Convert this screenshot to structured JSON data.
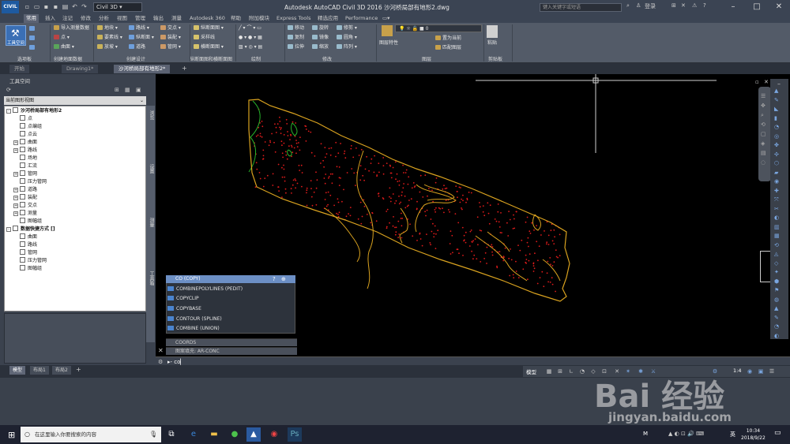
{
  "titlebar": {
    "app_button": "CIVIL",
    "workspace": "Civil 3D",
    "title": "Autodesk AutoCAD Civil 3D 2016    沙河桥局部有地形2.dwg",
    "search_placeholder": "键入关键字或短语",
    "login": "登录"
  },
  "ribbon_tabs": [
    "常用",
    "插入",
    "注记",
    "修改",
    "分析",
    "视图",
    "管理",
    "输出",
    "测量",
    "Autodesk 360",
    "帮助",
    "附加模块",
    "Express Tools",
    "精选应用",
    "Performance"
  ],
  "ribbon": {
    "big_button": "工具空间",
    "items": {
      "import_survey": "导入测量数据",
      "point": "点",
      "surface": "曲面",
      "parcel": "地块",
      "feature_line": "要素线",
      "grading": "放坡",
      "alignment": "路线",
      "profile": "纵断面",
      "corridor": "道路",
      "intersection": "交点",
      "assembly": "装配",
      "pipe_network": "管网",
      "profile_view": "纵断面图",
      "sample_line": "采样线",
      "section_view": "横断面图",
      "move": "移动",
      "rotate": "旋转",
      "trim": "修剪",
      "copy": "复制",
      "mirror": "镜像",
      "fillet": "圆角",
      "stretch": "拉伸",
      "scale": "缩放",
      "array": "阵列",
      "layer_properties": "图层特性",
      "layer_match": "置为当前",
      "layer_match2": "匹配图层",
      "paste": "粘贴",
      "layer_value": "0"
    },
    "panels": [
      "选项板",
      "创建地面数据",
      "创建设计",
      "纵断面图和横断面图",
      "绘制",
      "修改",
      "图层",
      "剪贴板"
    ]
  },
  "doc_tabs": [
    "开始",
    "Drawing1*",
    "沙河桥局部有地形2*"
  ],
  "toolspace": {
    "title": "工具空间",
    "view": "当前图形视图",
    "tree": [
      {
        "label": "沙河桥局部有地形2",
        "level": 0,
        "pm": "-"
      },
      {
        "label": "点",
        "level": 1,
        "pm": ""
      },
      {
        "label": "点编组",
        "level": 1,
        "pm": ""
      },
      {
        "label": "点云",
        "level": 1,
        "pm": ""
      },
      {
        "label": "曲面",
        "level": 1,
        "pm": "+"
      },
      {
        "label": "路线",
        "level": 1,
        "pm": "+"
      },
      {
        "label": "场地",
        "level": 1,
        "pm": ""
      },
      {
        "label": "汇流",
        "level": 1,
        "pm": ""
      },
      {
        "label": "管网",
        "level": 1,
        "pm": "+"
      },
      {
        "label": "压力管网",
        "level": 1,
        "pm": ""
      },
      {
        "label": "道路",
        "level": 1,
        "pm": "+"
      },
      {
        "label": "装配",
        "level": 1,
        "pm": "+"
      },
      {
        "label": "交点",
        "level": 1,
        "pm": "+"
      },
      {
        "label": "测量",
        "level": 1,
        "pm": "+"
      },
      {
        "label": "图幅组",
        "level": 1,
        "pm": ""
      },
      {
        "label": "数据快捷方式 []",
        "level": 0,
        "pm": "-"
      },
      {
        "label": "曲面",
        "level": 1,
        "pm": ""
      },
      {
        "label": "路线",
        "level": 1,
        "pm": ""
      },
      {
        "label": "管网",
        "level": 1,
        "pm": ""
      },
      {
        "label": "压力管网",
        "level": 1,
        "pm": ""
      },
      {
        "label": "图幅组",
        "level": 1,
        "pm": ""
      }
    ],
    "side_tabs": [
      "浏览",
      "设置",
      "测量",
      "工具箱"
    ]
  },
  "autocomplete": {
    "header": "CO (COPY)",
    "items": [
      "COMBINEPOLYLINES (PEDIT)",
      "COPYCLIP",
      "COPYBASE",
      "CONTOUR (SPLINE)",
      "COMBINE (UNION)"
    ],
    "sections": [
      "COORDS",
      "图案填充: AR-CONC"
    ]
  },
  "command": {
    "prefix": "▸-",
    "value": "co"
  },
  "layout_tabs": [
    "模型",
    "布局1",
    "布局2"
  ],
  "status": {
    "model": "模型",
    "scale": "1:4"
  },
  "taskbar": {
    "search_placeholder": "在这里输入你要搜索的内容",
    "time": "10:34",
    "date": "2018/9/22",
    "ime": "英"
  },
  "watermark": {
    "line1": "Bai 经验",
    "line2": "jingyan.baidu.com"
  },
  "colors": {
    "boundary": "#d9a21f",
    "contour_green": "#27b32a",
    "points": "#e01b1b"
  }
}
